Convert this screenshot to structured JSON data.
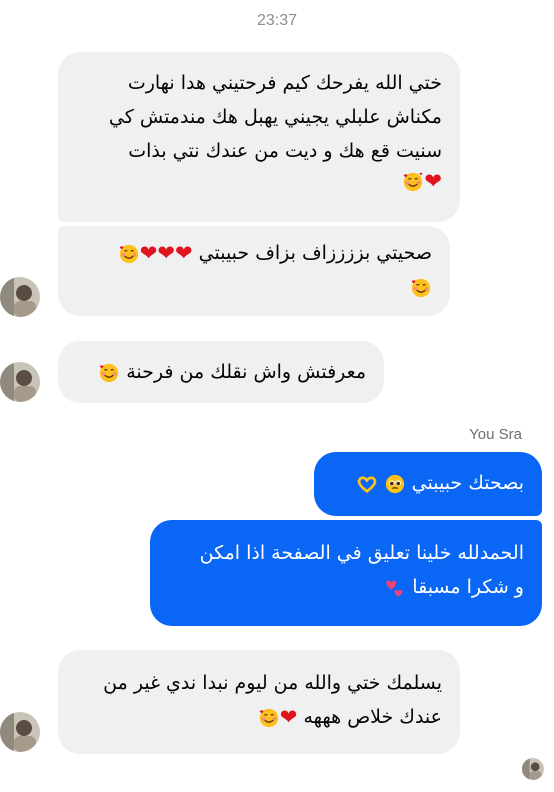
{
  "status": {
    "time": "23:37"
  },
  "messages": [
    {
      "sender": "other",
      "lines": [
        "ختي الله يفرحك كيم فرحتيني هدا نهارت",
        "مكناش علبلي يجيني يهبل هك مندمتش كي",
        "سنيت قع هك و ديت من عندك نتي بذات"
      ],
      "emoji": [
        "heart-icon",
        "smiling-face-with-hearts-icon"
      ]
    },
    {
      "sender": "other",
      "text": "صحيتي بززززاف بزاف حبيبتي",
      "emoji": [
        "heart-icon",
        "heart-icon",
        "heart-icon",
        "smiling-face-with-hearts-icon",
        "smiling-face-with-hearts-icon"
      ]
    },
    {
      "sender": "other",
      "text": "معرفتش واش نقلك من فرحنة",
      "emoji": [
        "smiling-face-with-hearts-icon"
      ]
    },
    {
      "sender": "me",
      "text": "بصحتك حبيبتي",
      "emoji": [
        "pleading-face-icon",
        "heart-hands-icon"
      ]
    },
    {
      "sender": "me",
      "lines": [
        "الحمدلله خلينا تعليق في الصفحة اذا امكن",
        "و شكرا مسبقا"
      ],
      "emoji": [
        "two-hearts-icon"
      ]
    },
    {
      "sender": "other",
      "lines": [
        "يسلمك ختي والله من ليوم نبدا ندي غير من",
        "عندك خلاص هههه"
      ],
      "emoji": [
        "heart-icon",
        "smiling-face-with-hearts-icon"
      ]
    }
  ],
  "sender_label": "You Sra",
  "colors": {
    "outgoing_bubble": "#0a66f5",
    "incoming_bubble": "#f0f0f0",
    "heart": "#e0141e"
  }
}
